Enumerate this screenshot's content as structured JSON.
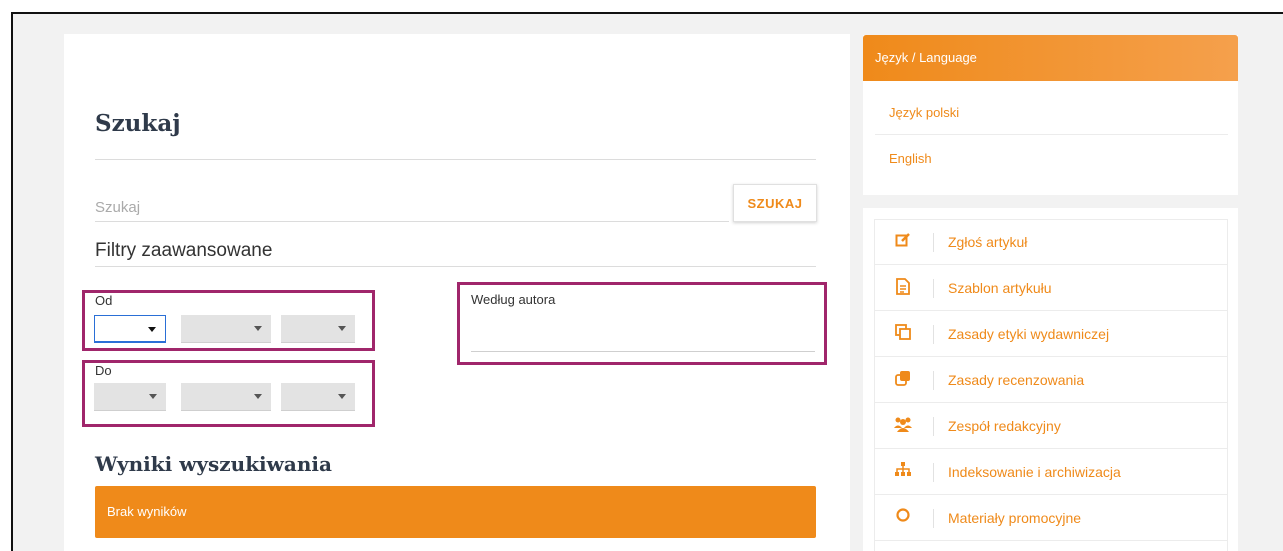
{
  "search": {
    "title": "Szukaj",
    "placeholder": "Szukaj",
    "button_label": "SZUKAJ",
    "filters_title": "Filtry zaawansowane",
    "from_label": "Od",
    "to_label": "Do",
    "author_label": "Według autora"
  },
  "results": {
    "title": "Wyniki wyszukiwania",
    "empty_message": "Brak wyników"
  },
  "language": {
    "header": "Język / Language",
    "options": [
      "Język polski",
      "English"
    ]
  },
  "sidebar_menu": [
    {
      "label": "Zgłoś artykuł",
      "icon": "edit-icon"
    },
    {
      "label": "Szablon artykułu",
      "icon": "document-icon"
    },
    {
      "label": "Zasady etyki wydawniczej",
      "icon": "copy-icon"
    },
    {
      "label": "Zasady recenzowania",
      "icon": "clone-icon"
    },
    {
      "label": "Zespół redakcyjny",
      "icon": "users-icon"
    },
    {
      "label": "Indeksowanie i archiwizacja",
      "icon": "sitemap-icon"
    },
    {
      "label": "Materiały promocyjne",
      "icon": "circle-icon"
    }
  ],
  "colors": {
    "accent": "#ef8a1a",
    "highlight_box": "#a0266b",
    "heading": "#2f3a4a"
  }
}
